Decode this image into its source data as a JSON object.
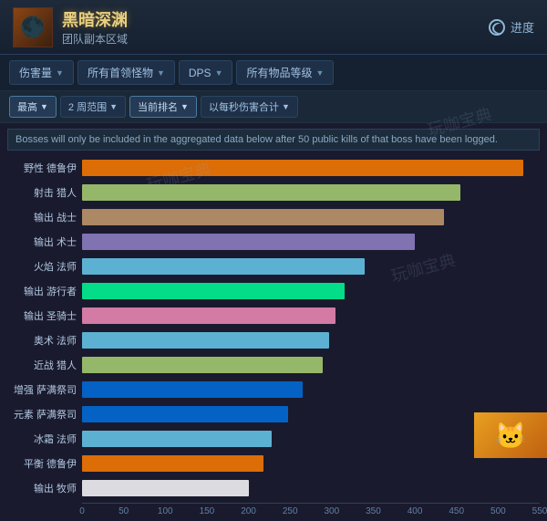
{
  "header": {
    "title": "黑暗深渊",
    "subtitle": "团队副本区域",
    "progress_label": "进度",
    "icon": "🌑"
  },
  "nav": {
    "items": [
      {
        "label": "伤害量",
        "id": "damage"
      },
      {
        "label": "所有首领怪物",
        "id": "bosses"
      },
      {
        "label": "DPS",
        "id": "dps"
      },
      {
        "label": "所有物品等级",
        "id": "ilvl"
      }
    ]
  },
  "filters": [
    {
      "label": "最高",
      "id": "highest",
      "active": true
    },
    {
      "label": "2 周范围",
      "id": "range",
      "active": false
    },
    {
      "label": "当前排名",
      "id": "current",
      "active": true
    },
    {
      "label": "以每秒伤害合计",
      "id": "dps-total",
      "active": false
    }
  ],
  "notice": "Bosses will only be included in the aggregated data below after 50 public kills of that boss have been logged.",
  "chart": {
    "max_value": 550,
    "x_ticks": [
      0,
      50,
      100,
      150,
      200,
      250,
      300,
      350,
      400,
      450,
      500,
      550
    ],
    "bars": [
      {
        "label": "野性 德鲁伊",
        "value": 530,
        "color": "#ff7d00"
      },
      {
        "label": "射击 猎人",
        "value": 455,
        "color": "#abd473"
      },
      {
        "label": "输出 战士",
        "value": 435,
        "color": "#c79c6e"
      },
      {
        "label": "输出 术士",
        "value": 400,
        "color": "#9482c9"
      },
      {
        "label": "火焰 法师",
        "value": 340,
        "color": "#69ccf0"
      },
      {
        "label": "输出 游行者",
        "value": 315,
        "color": "#00ff98"
      },
      {
        "label": "输出 圣骑士",
        "value": 305,
        "color": "#f58cba"
      },
      {
        "label": "奥术 法师",
        "value": 297,
        "color": "#69ccf0"
      },
      {
        "label": "近战 猎人",
        "value": 289,
        "color": "#abd473"
      },
      {
        "label": "增强 萨满祭司",
        "value": 265,
        "color": "#0070de"
      },
      {
        "label": "元素 萨满祭司",
        "value": 248,
        "color": "#0070de"
      },
      {
        "label": "冰霜 法师",
        "value": 228,
        "color": "#69ccf0"
      },
      {
        "label": "平衡 德鲁伊",
        "value": 218,
        "color": "#ff7d00"
      },
      {
        "label": "输出 牧师",
        "value": 200,
        "color": "#ffffff"
      }
    ]
  },
  "bottom_image": "🐱"
}
